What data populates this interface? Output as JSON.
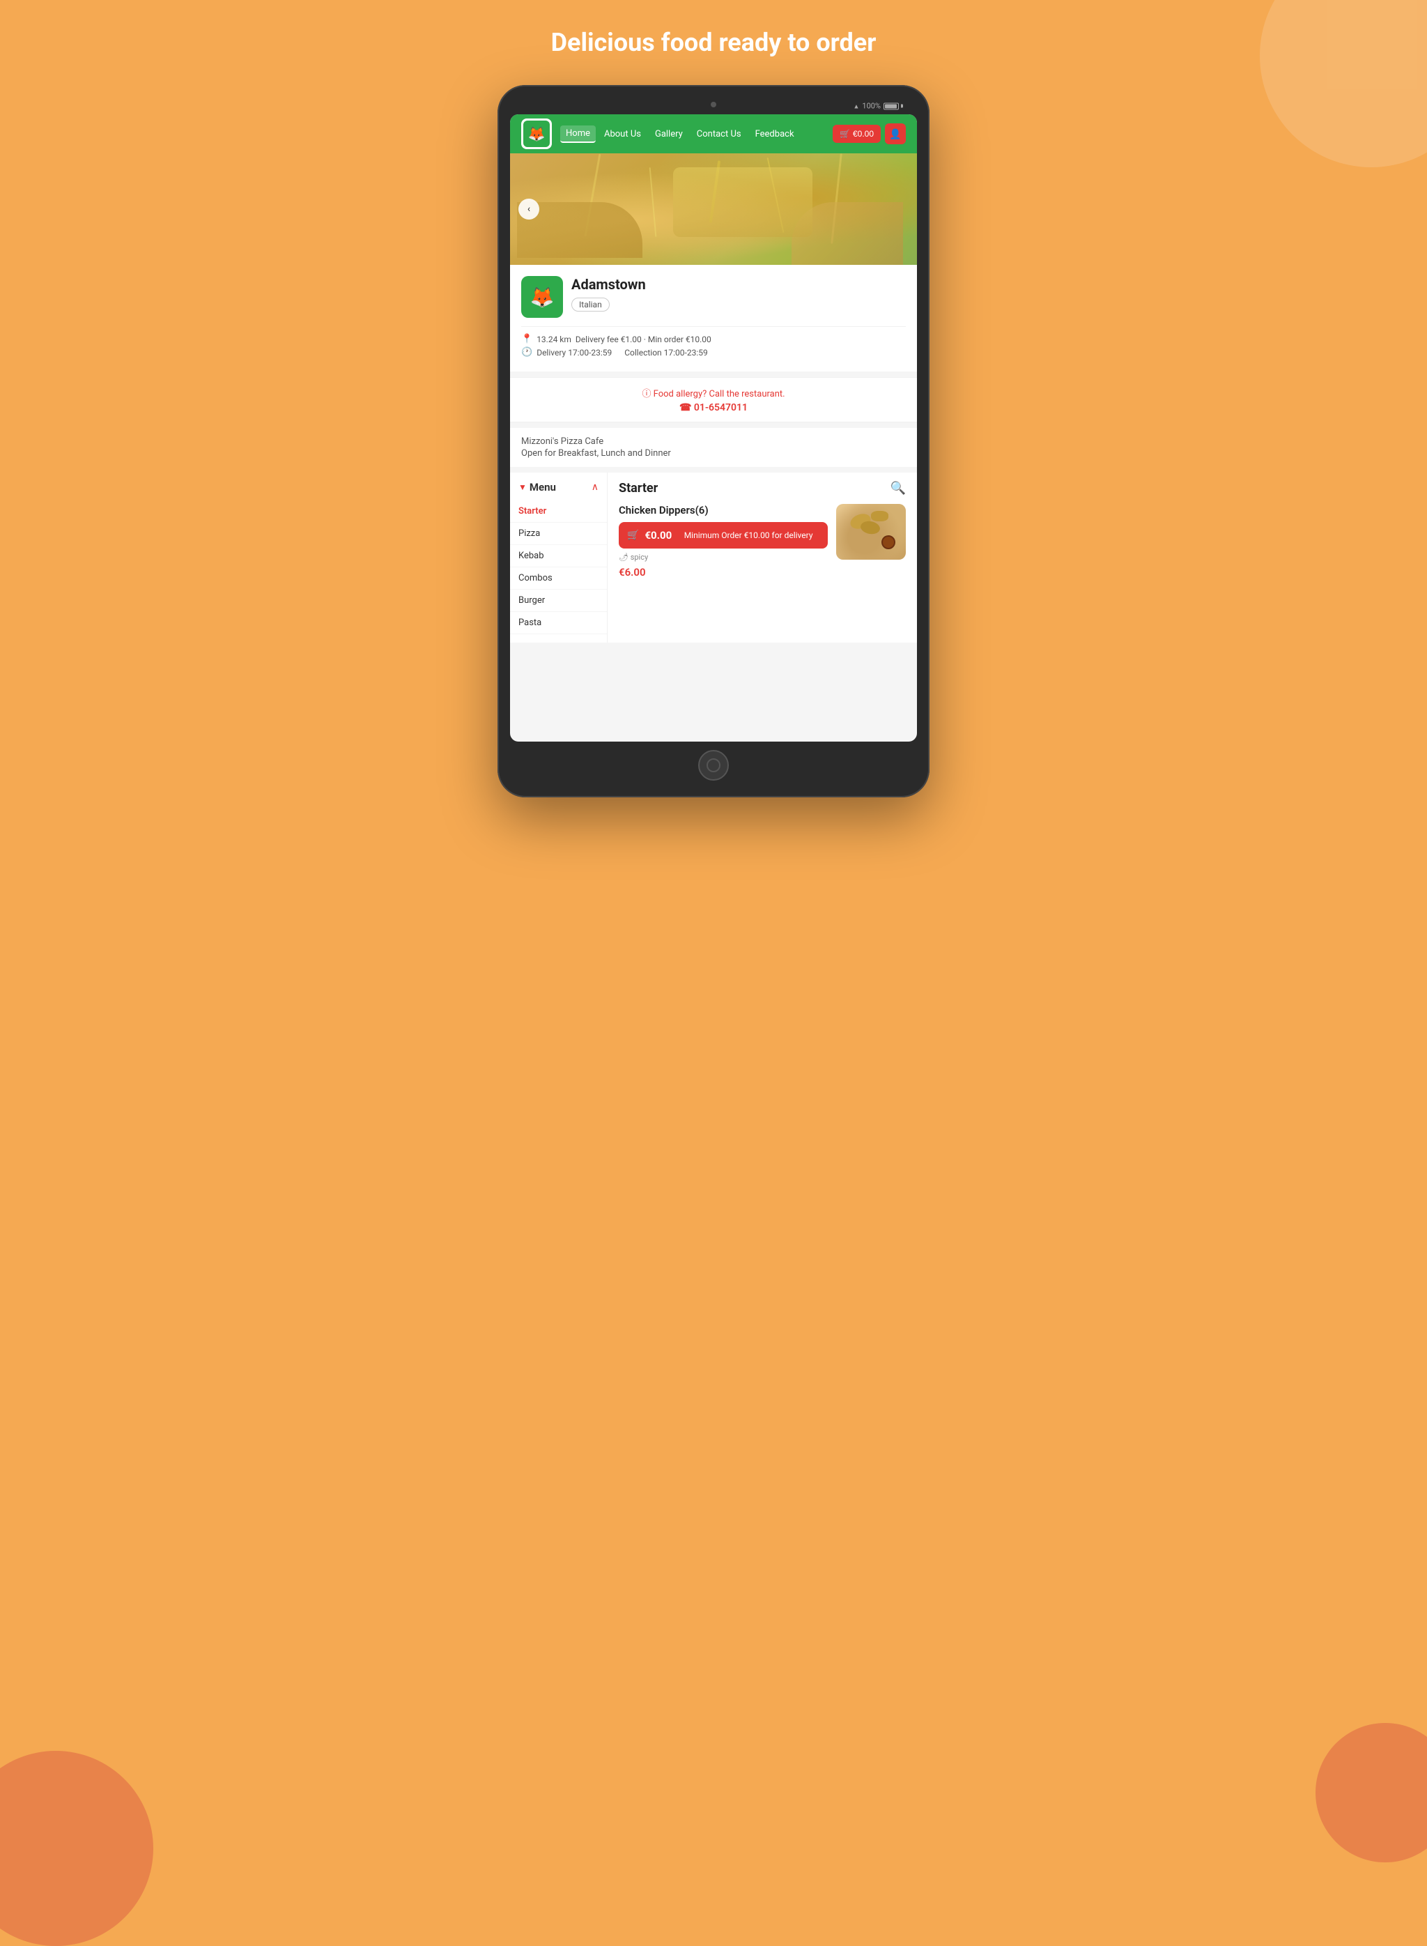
{
  "page": {
    "title": "Delicious food ready to order",
    "background_color": "#F5A952"
  },
  "tablet": {
    "status": {
      "wifi": "WiFi",
      "battery_percent": "100%"
    }
  },
  "navbar": {
    "logo_emoji": "🦊",
    "links": [
      {
        "label": "Home",
        "active": true
      },
      {
        "label": "About Us",
        "active": false
      },
      {
        "label": "Gallery",
        "active": false
      },
      {
        "label": "Contact Us",
        "active": false
      },
      {
        "label": "Feedback",
        "active": false
      }
    ],
    "cart_label": "€0.00",
    "user_icon": "👤"
  },
  "hero": {
    "back_button": "‹"
  },
  "restaurant": {
    "name": "Adamstown",
    "tag": "Italian",
    "logo_emoji": "🦊",
    "distance": "13.24 km",
    "delivery_fee": "Delivery fee €1.00 · Min order €10.00",
    "delivery_hours": "Delivery 17:00-23:59",
    "collection_hours": "Collection 17:00-23:59",
    "allergy_text": "ⓘ Food allergy? Call the restaurant.",
    "phone": "☎ 01-6547011",
    "cafe_name": "Mizzoni's Pizza Cafe",
    "cafe_hours": "Open for Breakfast, Lunch and Dinner"
  },
  "menu": {
    "label": "Menu",
    "items": [
      {
        "label": "Starter",
        "active": true
      },
      {
        "label": "Pizza",
        "active": false
      },
      {
        "label": "Kebab",
        "active": false
      },
      {
        "label": "Combos",
        "active": false
      },
      {
        "label": "Burger",
        "active": false
      },
      {
        "label": "Pasta",
        "active": false
      }
    ]
  },
  "menu_content": {
    "category": "Starter",
    "food_item": {
      "name": "Chicken Dippers(6)",
      "cart_price": "€0.00",
      "cart_text": "Minimum Order €10.00 for delivery",
      "spicy_label": "🌶 spicy",
      "price": "€6.00",
      "image_emoji": "🍗"
    }
  }
}
